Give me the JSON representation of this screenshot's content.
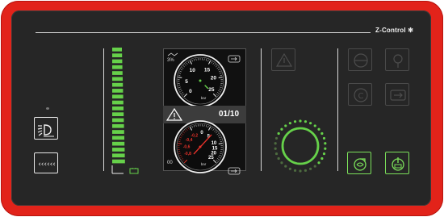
{
  "brand": {
    "label": "Z-Control",
    "mark": "✻"
  },
  "display": {
    "pressure_top": {
      "unit": "bar",
      "ticks": [
        "5",
        "10",
        "15",
        "20",
        "25",
        "0"
      ],
      "corner_label": "3%"
    },
    "pressure_bottom": {
      "unit": "bar",
      "ticks_pos": [
        "5",
        "10",
        "15",
        "20",
        "25"
      ],
      "ticks_neg": [
        "-0,2",
        "-0,4",
        "-0,6",
        "-0,8"
      ],
      "zero": "0",
      "corner_label": "00"
    },
    "alarm_counter": "01/10"
  },
  "icons": {
    "work_light": "work-light-icon",
    "horn": "horn-icon",
    "warning_top": "warning-icon",
    "warning_display": "warning-icon",
    "steering": "steering-wheel-icon",
    "location": "location-pin-icon",
    "engine_c": "engine-c-icon",
    "exit": "exit-icon",
    "pump": "pump-icon",
    "power": "power-icon",
    "battery": "battery-icon"
  },
  "colors": {
    "frame": "#e2231a",
    "panel": "#262626",
    "accent": "#66d14a",
    "red_scale": "#e8322a"
  },
  "level_bar": {
    "segments_total": 20,
    "segments_lit": 20
  }
}
